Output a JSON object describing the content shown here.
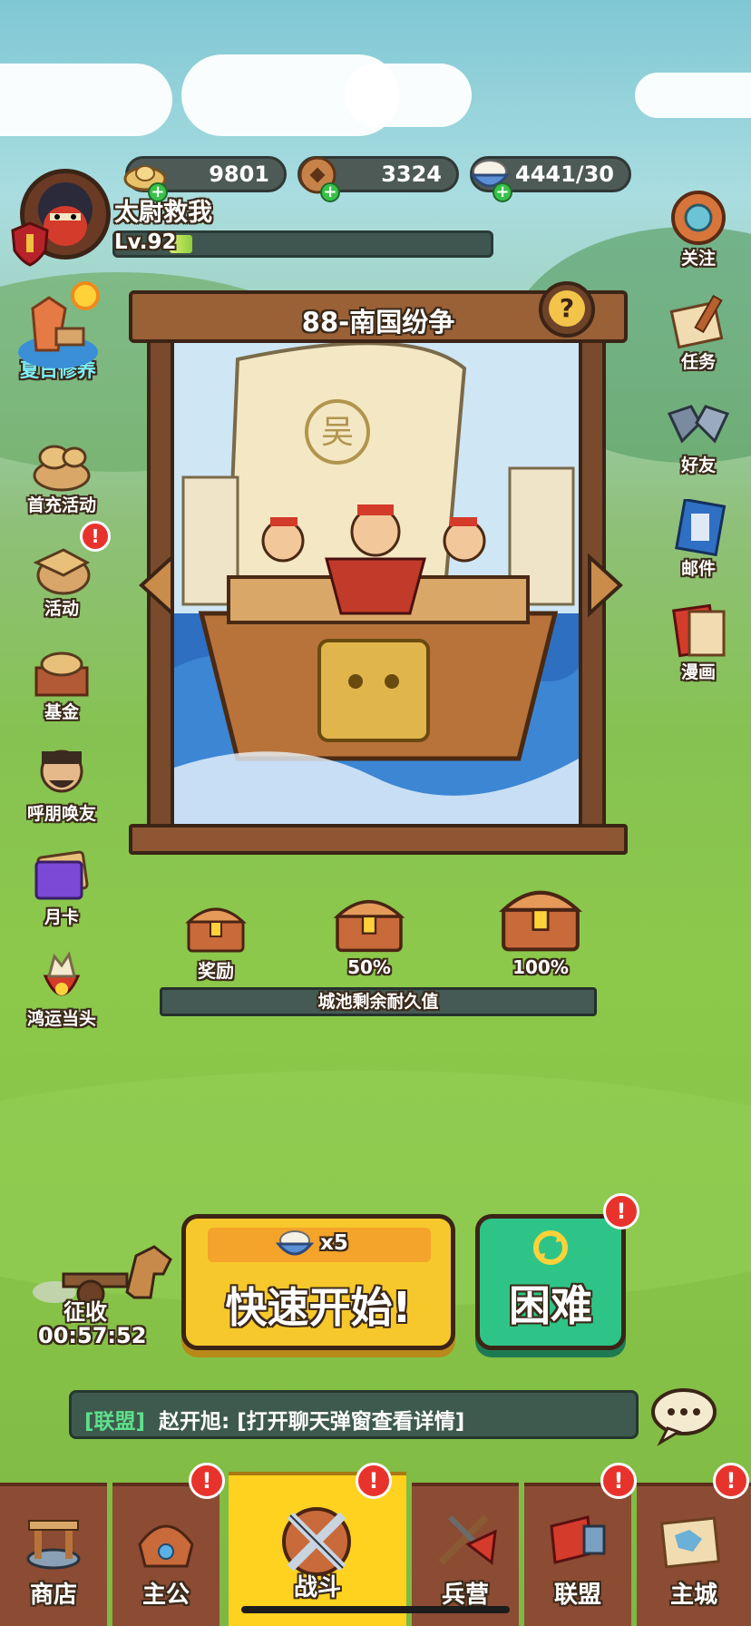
{
  "player": {
    "name": "太尉救我",
    "level": "Lv.92",
    "exp_progress": 0.07
  },
  "resources": [
    {
      "icon": "gold-ingot-icon",
      "value": "9801"
    },
    {
      "icon": "copper-coin-icon",
      "value": "3324"
    },
    {
      "icon": "rice-bowl-icon",
      "value": "4441/30"
    }
  ],
  "left_menu": [
    {
      "icon": "summer-event-icon",
      "label": "夏日修养",
      "highlight": true
    },
    {
      "icon": "first-recharge-icon",
      "label": "首充活动"
    },
    {
      "icon": "activity-icon",
      "label": "活动",
      "badge": "!"
    },
    {
      "icon": "fund-icon",
      "label": "基金"
    },
    {
      "icon": "invite-friends-icon",
      "label": "呼朋唤友"
    },
    {
      "icon": "monthly-card-icon",
      "label": "月卡"
    },
    {
      "icon": "lucky-bag-icon",
      "label": "鸿运当头"
    }
  ],
  "right_menu": [
    {
      "icon": "follow-icon",
      "label": "关注"
    },
    {
      "icon": "quest-icon",
      "label": "任务"
    },
    {
      "icon": "friends-icon",
      "label": "好友"
    },
    {
      "icon": "mail-icon",
      "label": "邮件"
    },
    {
      "icon": "comic-icon",
      "label": "漫画"
    }
  ],
  "stage": {
    "title": "88-南国纷争",
    "help": "?",
    "sail_mark": "吴"
  },
  "rewards": [
    {
      "label": "奖励"
    },
    {
      "label": "50%"
    },
    {
      "label": "100%"
    }
  ],
  "durability_label": "城池剩余耐久值",
  "collect": {
    "label": "征收",
    "timer": "00:57:52"
  },
  "quick_start": {
    "cost": "x5",
    "label": "快速开始!"
  },
  "difficulty": {
    "label": "困难",
    "badge": "!"
  },
  "chat": {
    "channel": "[联盟]",
    "message": "赵开旭: [打开聊天弹窗查看详情]"
  },
  "bottom_nav": [
    {
      "icon": "shop-icon",
      "label": "商店"
    },
    {
      "icon": "lord-icon",
      "label": "主公",
      "badge": "!"
    },
    {
      "icon": "battle-icon",
      "label": "战斗",
      "badge": "!",
      "active": true
    },
    {
      "icon": "barracks-icon",
      "label": "兵营"
    },
    {
      "icon": "alliance-icon",
      "label": "联盟",
      "badge": "!"
    },
    {
      "icon": "main-city-icon",
      "label": "主城",
      "badge": "!"
    }
  ],
  "colors": {
    "quick_start": "#f7c82b",
    "difficulty": "#2fc487",
    "badge": "#e8332c",
    "nav_bg": "#8c4b33",
    "nav_active": "#ffd21f"
  }
}
